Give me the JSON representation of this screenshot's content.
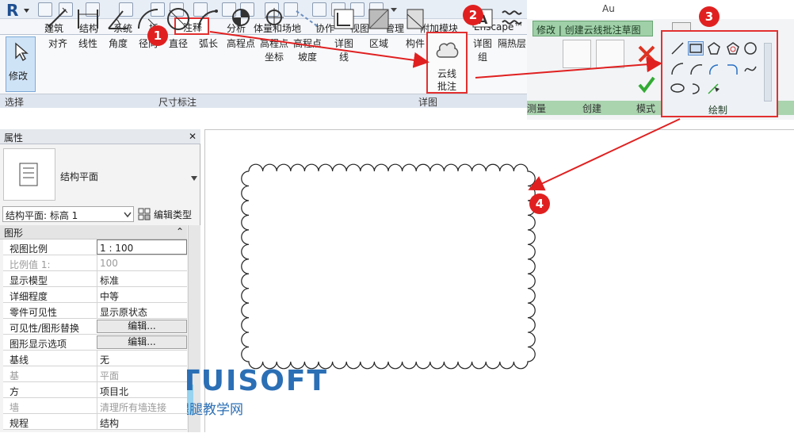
{
  "app_title": "Au",
  "tabs": [
    "建筑",
    "结构",
    "系统",
    "插",
    "注释",
    "分析",
    "体量和场地",
    "协作",
    "视图",
    "管理",
    "附加模块",
    "Enscape™"
  ],
  "context_tab_title": "修改 | 创建云线批注草图",
  "ribbon": {
    "modify": "修改",
    "dims": [
      "对齐",
      "线性",
      "角度",
      "径向",
      "直径",
      "弧长",
      "高程点"
    ],
    "elev_coord": [
      "高程点",
      "坐标"
    ],
    "elev_slope": [
      "高程点",
      "坡度"
    ],
    "detail_line": [
      "详图",
      "线"
    ],
    "region": "区域",
    "component": "构件",
    "revision_cloud": [
      "云线",
      "批注"
    ],
    "detail_group": [
      "详图",
      "组"
    ],
    "insulation": "隔热层"
  },
  "panels": {
    "select": "选择",
    "dimension": "尺寸标注",
    "detail": "详图",
    "measure": "测量",
    "create": "创建",
    "mode": "模式",
    "draw": "绘制"
  },
  "properties": {
    "title": "属性",
    "close": "✕",
    "type_name": "结构平面",
    "instance_select": "结构平面: 标高 1",
    "edit_type": "编辑类型",
    "group": "图形",
    "group_toggle": "⌃",
    "rows": [
      {
        "k": "视图比例",
        "v": "1 : 100",
        "kind": "input"
      },
      {
        "k": "比例值 1:",
        "v": "100",
        "kind": "dim"
      },
      {
        "k": "显示模型",
        "v": "标准",
        "kind": "text"
      },
      {
        "k": "详细程度",
        "v": "中等",
        "kind": "text"
      },
      {
        "k": "零件可见性",
        "v": "显示原状态",
        "kind": "text"
      },
      {
        "k": "可见性/图形替换",
        "v": "编辑...",
        "kind": "button"
      },
      {
        "k": "图形显示选项",
        "v": "编辑...",
        "kind": "button"
      },
      {
        "k": "基线",
        "v": "无",
        "kind": "text"
      },
      {
        "k": "基",
        "v": "平面",
        "kind": "dim"
      },
      {
        "k": "方",
        "v": "项目北",
        "kind": "text"
      },
      {
        "k": "墙",
        "v": "清理所有墙连接",
        "kind": "dim"
      },
      {
        "k": "规程",
        "v": "结构",
        "kind": "text"
      }
    ]
  },
  "badges": [
    "1",
    "2",
    "3",
    "4"
  ],
  "watermark": {
    "brand": "TUITUISOFT",
    "sub": "腿腿教学网"
  },
  "colors": {
    "accent": "#e23030",
    "context_green": "#9fd0a8",
    "brand_blue": "#2b6fb5"
  }
}
